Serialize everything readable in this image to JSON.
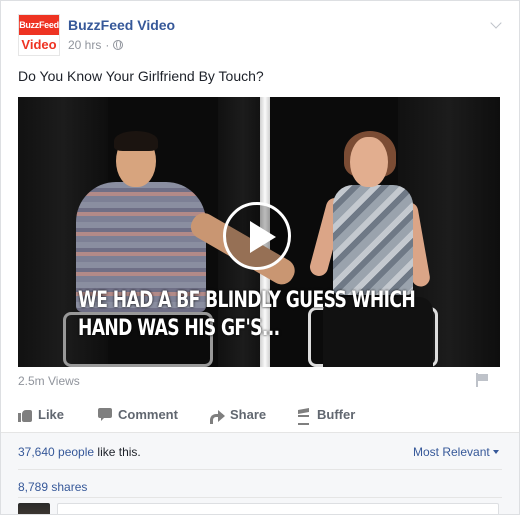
{
  "post": {
    "logo_top": "BuzzFeed",
    "logo_bottom": "Video",
    "page_name": "BuzzFeed Video",
    "time": "20 hrs",
    "separator": "·",
    "text": "Do You Know Your Girlfriend By Touch?"
  },
  "video": {
    "caption": "WE HAD A BF BLINDLY GUESS WHICH HAND WAS HIS GF'S...",
    "views": "2.5m Views"
  },
  "actions": {
    "like": "Like",
    "comment": "Comment",
    "share": "Share",
    "buffer": "Buffer"
  },
  "footer": {
    "likes_count": "37,640 people",
    "likes_suffix": " like this.",
    "sort": "Most Relevant",
    "shares": "8,789 shares"
  },
  "colors": {
    "link": "#365899",
    "brand": "#ee3322",
    "muted": "#90949c"
  }
}
